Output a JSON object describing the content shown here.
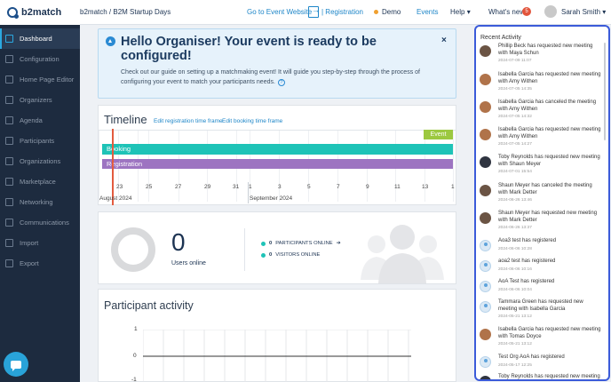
{
  "header": {
    "logo_text": "b2match",
    "breadcrumb": "b2match / B2M Startup Days",
    "goto_event": "Go to Event Website",
    "registration": "| Registration",
    "demo": "Demo",
    "events": "Events",
    "help": "Help",
    "help_arrow": "▾",
    "whats_new": "What's new",
    "whats_new_count": "5",
    "user_name": "Sarah Smith",
    "user_arrow": "▾"
  },
  "sidebar": {
    "items": [
      {
        "label": "Dashboard",
        "icon": "dashboard-icon"
      },
      {
        "label": "Configuration",
        "icon": "gear-icon"
      },
      {
        "label": "Home Page Editor",
        "icon": "home-icon"
      },
      {
        "label": "Organizers",
        "icon": "users-icon"
      },
      {
        "label": "Agenda",
        "icon": "agenda-icon"
      },
      {
        "label": "Participants",
        "icon": "participants-icon"
      },
      {
        "label": "Organizations",
        "icon": "organizations-icon"
      },
      {
        "label": "Marketplace",
        "icon": "marketplace-icon"
      },
      {
        "label": "Networking",
        "icon": "networking-icon"
      },
      {
        "label": "Communications",
        "icon": "communications-icon"
      },
      {
        "label": "Import",
        "icon": "import-icon"
      },
      {
        "label": "Export",
        "icon": "export-icon"
      }
    ]
  },
  "banner": {
    "title": "Hello Organiser! Your event is ready to be configured!",
    "body": "Check out our guide on setting up a matchmaking event! It will guide you step-by-step through the process of configuring your event to match your participants needs.",
    "close": "×",
    "help_glyph": "?"
  },
  "timeline": {
    "title": "Timeline",
    "edit_registration": "Edit registration time frame",
    "edit_booking": "Edit booking time frame",
    "event_label": "Event",
    "booking_label": "Booking",
    "registration_label": "Registration",
    "ticks_august": [
      "23",
      "25",
      "27",
      "29",
      "31"
    ],
    "ticks_september": [
      "1",
      "3",
      "5",
      "7",
      "9",
      "11",
      "13",
      "1"
    ],
    "month_august": "August 2024",
    "month_september": "September 2024"
  },
  "users": {
    "count": "0",
    "label": "Users online",
    "participants_count": "0",
    "participants_label": "PARTICIPANTS ONLINE",
    "participants_arrow": "➔",
    "visitors_count": "0",
    "visitors_label": "VISITORS ONLINE"
  },
  "activity": {
    "title": "Participant activity",
    "y_ticks": [
      "1",
      "0",
      "-1"
    ]
  },
  "recent": {
    "title": "Recent Activity",
    "entries": [
      {
        "text": "Phillip Beck has requested new meeting with Maya Schun",
        "date": "2024-07-09 11:07",
        "avatar": "photo"
      },
      {
        "text": "Isabella Garcia has requested new meeting with Amy Withen",
        "date": "2024-07-05 14:35",
        "avatar": "photo2"
      },
      {
        "text": "Isabella Garcia has canceled the meeting with Amy Withen",
        "date": "2024-07-05 14:32",
        "avatar": "photo2"
      },
      {
        "text": "Isabella Garcia has requested new meeting with Amy Withen",
        "date": "2024-07-05 14:27",
        "avatar": "photo2"
      },
      {
        "text": "Toby Reynolds has requested new meeting with Shaun Meyer",
        "date": "2024-07-01 15:54",
        "avatar": "photo3"
      },
      {
        "text": "Shaun Meyer has canceled the meeting with Mark Detter",
        "date": "2024-06-26 13:46",
        "avatar": "photo"
      },
      {
        "text": "Shaun Meyer has requested new meeting with Mark Detter",
        "date": "2024-06-26 13:37",
        "avatar": "photo"
      },
      {
        "text": "Aoa3 test has registered",
        "date": "2024-06-06 10:28",
        "avatar": "blue"
      },
      {
        "text": "aoa2 test has registered",
        "date": "2024-06-06 10:16",
        "avatar": "blue"
      },
      {
        "text": "AoA Test has registered",
        "date": "2024-06-06 10:04",
        "avatar": "blue"
      },
      {
        "text": "Tammara Green has requested new meeting with Isabella Garcia",
        "date": "2024-05-21 13:12",
        "avatar": "blue"
      },
      {
        "text": "Isabella Garcia has requested new meeting with Tomas Doyce",
        "date": "2024-05-21 13:12",
        "avatar": "photo2"
      },
      {
        "text": "Test Org AoA has registered",
        "date": "2024-05-17 12:25",
        "avatar": "blue"
      },
      {
        "text": "Toby Reynolds has requested new meeting",
        "date": "",
        "avatar": "photo3"
      }
    ]
  },
  "colors": {
    "accent": "#1e86c8",
    "sidebar": "#1d2b3f",
    "booking": "#1ec3b7",
    "registration": "#9d74c1",
    "event": "#9cc840",
    "today": "#e35b3f",
    "highlight": "#3b5bd9"
  }
}
